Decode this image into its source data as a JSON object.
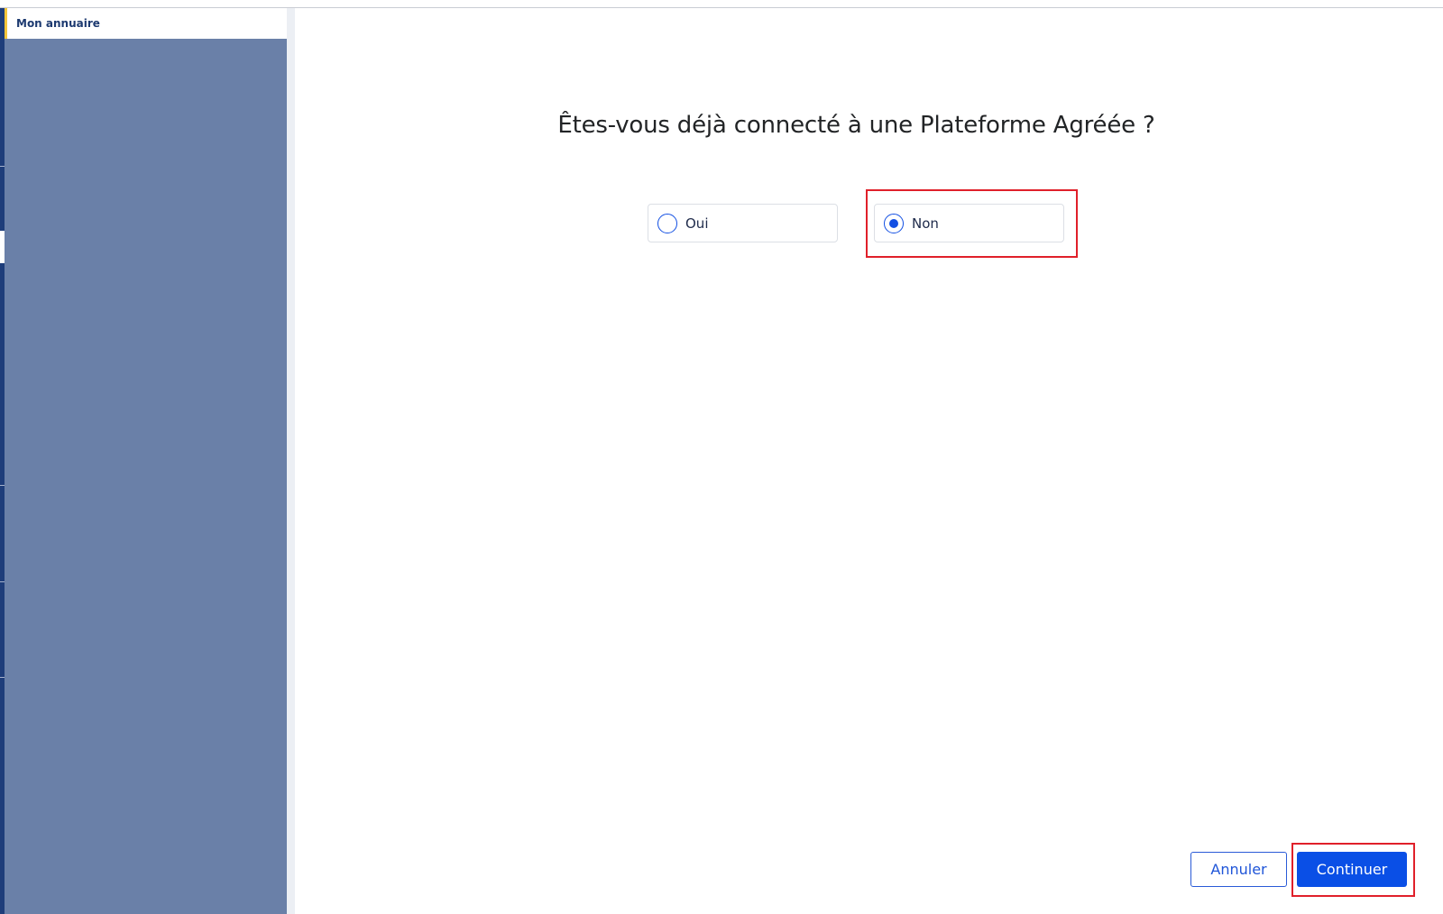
{
  "sidebar": {
    "items": [
      {
        "label": "Mon annuaire"
      }
    ]
  },
  "dialog": {
    "question": "Êtes-vous déjà connecté à une Plateforme Agréée ?",
    "options": [
      {
        "label": "Oui",
        "selected": false
      },
      {
        "label": "Non",
        "selected": true
      }
    ]
  },
  "footer": {
    "cancel_label": "Annuler",
    "continue_label": "Continuer"
  },
  "colors": {
    "sidebar_bg": "#6a80a8",
    "accent": "#f6c63a",
    "primary": "#0a4fe6",
    "highlight": "#e0202a"
  }
}
